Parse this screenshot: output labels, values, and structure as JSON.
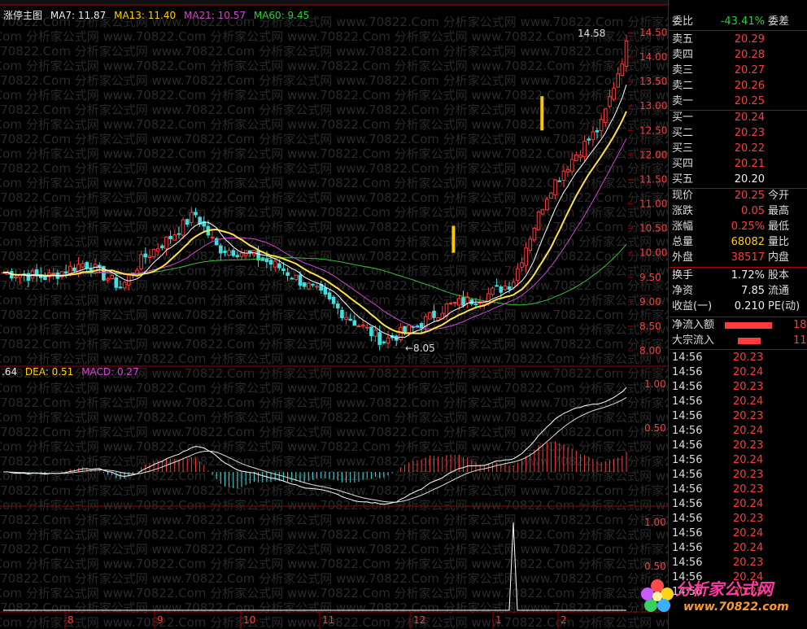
{
  "legend_main": {
    "title": "涨停主图",
    "ma7": "MA7: 11.87",
    "ma13": "MA13: 11.40",
    "ma21": "MA21: 10.57",
    "ma60": "MA60: 9.45"
  },
  "legend_macd": {
    "dif": ".64",
    "dea": "DEA: 0.51",
    "macd": "MACD: 0.27"
  },
  "price_axis": [
    "14.50",
    "14.00",
    "13.50",
    "13.00",
    "12.50",
    "12.00",
    "11.50",
    "11.00",
    "10.50",
    "10.00",
    "9.50",
    "9.00",
    "8.50",
    "8.00"
  ],
  "macd_axis": [
    "1.00",
    "0.50"
  ],
  "vol_axis": [
    "1.00",
    "0.50"
  ],
  "month_labels": [
    "8",
    "9",
    "10",
    "11",
    "12",
    "1",
    "2"
  ],
  "annotation_high": "14.58",
  "annotation_low": "8.05",
  "watermark": "www.70822.Com 分析家公式网",
  "colors": {
    "up": "#ff3b3b",
    "down": "#3fe0e0",
    "ma7": "#ffffff",
    "ma13": "#ffe24a",
    "ma21": "#d046d0",
    "ma60": "#35c035",
    "grid": "#a00000"
  },
  "panel": {
    "weibi": {
      "label": "委比",
      "value": "-43.41%",
      "right": "委差"
    },
    "asks": [
      {
        "label": "卖五",
        "price": "20.29"
      },
      {
        "label": "卖四",
        "price": "20.28"
      },
      {
        "label": "卖三",
        "price": "20.27"
      },
      {
        "label": "卖二",
        "price": "20.26"
      },
      {
        "label": "卖一",
        "price": "20.25"
      }
    ],
    "bids": [
      {
        "label": "买一",
        "price": "20.24"
      },
      {
        "label": "买二",
        "price": "20.23"
      },
      {
        "label": "买三",
        "price": "20.22"
      },
      {
        "label": "买四",
        "price": "20.21"
      },
      {
        "label": "买五",
        "price": "20.20"
      }
    ],
    "quote": [
      {
        "label": "现价",
        "value": "20.25",
        "right": "今开"
      },
      {
        "label": "涨跌",
        "value": "0.05",
        "right": "最高"
      },
      {
        "label": "涨幅",
        "value": "0.25%",
        "right": "最低"
      },
      {
        "label": "总量",
        "value": "68082",
        "right": "量比"
      },
      {
        "label": "外盘",
        "value": "38517",
        "right": "内盘"
      }
    ],
    "stats": [
      {
        "label": "换手",
        "value": "1.72%",
        "right": "股本"
      },
      {
        "label": "净资",
        "value": "7.85",
        "right": "流通"
      },
      {
        "label": "收益(一)",
        "value": "0.210",
        "right": "PE(动)"
      }
    ],
    "flows": [
      {
        "label": "净流入额",
        "value": "18"
      },
      {
        "label": "大宗流入",
        "value": "11"
      }
    ],
    "ticks": [
      {
        "time": "14:56",
        "price": "20.23"
      },
      {
        "time": "14:56",
        "price": "20.24"
      },
      {
        "time": "14:56",
        "price": "20.23"
      },
      {
        "time": "14:56",
        "price": "20.24"
      },
      {
        "time": "14:56",
        "price": "20.23"
      },
      {
        "time": "14:56",
        "price": "20.24"
      },
      {
        "time": "14:56",
        "price": "20.23"
      },
      {
        "time": "14:56",
        "price": "20.24"
      },
      {
        "time": "14:56",
        "price": "20.23"
      },
      {
        "time": "14:56",
        "price": "20.23"
      },
      {
        "time": "14:56",
        "price": "20.24"
      },
      {
        "time": "14:56",
        "price": "20.23"
      },
      {
        "time": "14:56",
        "price": "20.24"
      },
      {
        "time": "14:56",
        "price": "20.24"
      },
      {
        "time": "14:56",
        "price": "20.23"
      },
      {
        "time": "14:56",
        "price": "20.24"
      },
      {
        "time": "14:56",
        "price": "20.25"
      }
    ]
  },
  "logo": {
    "name": "分析家公式网",
    "url": "www.70822.com"
  }
}
